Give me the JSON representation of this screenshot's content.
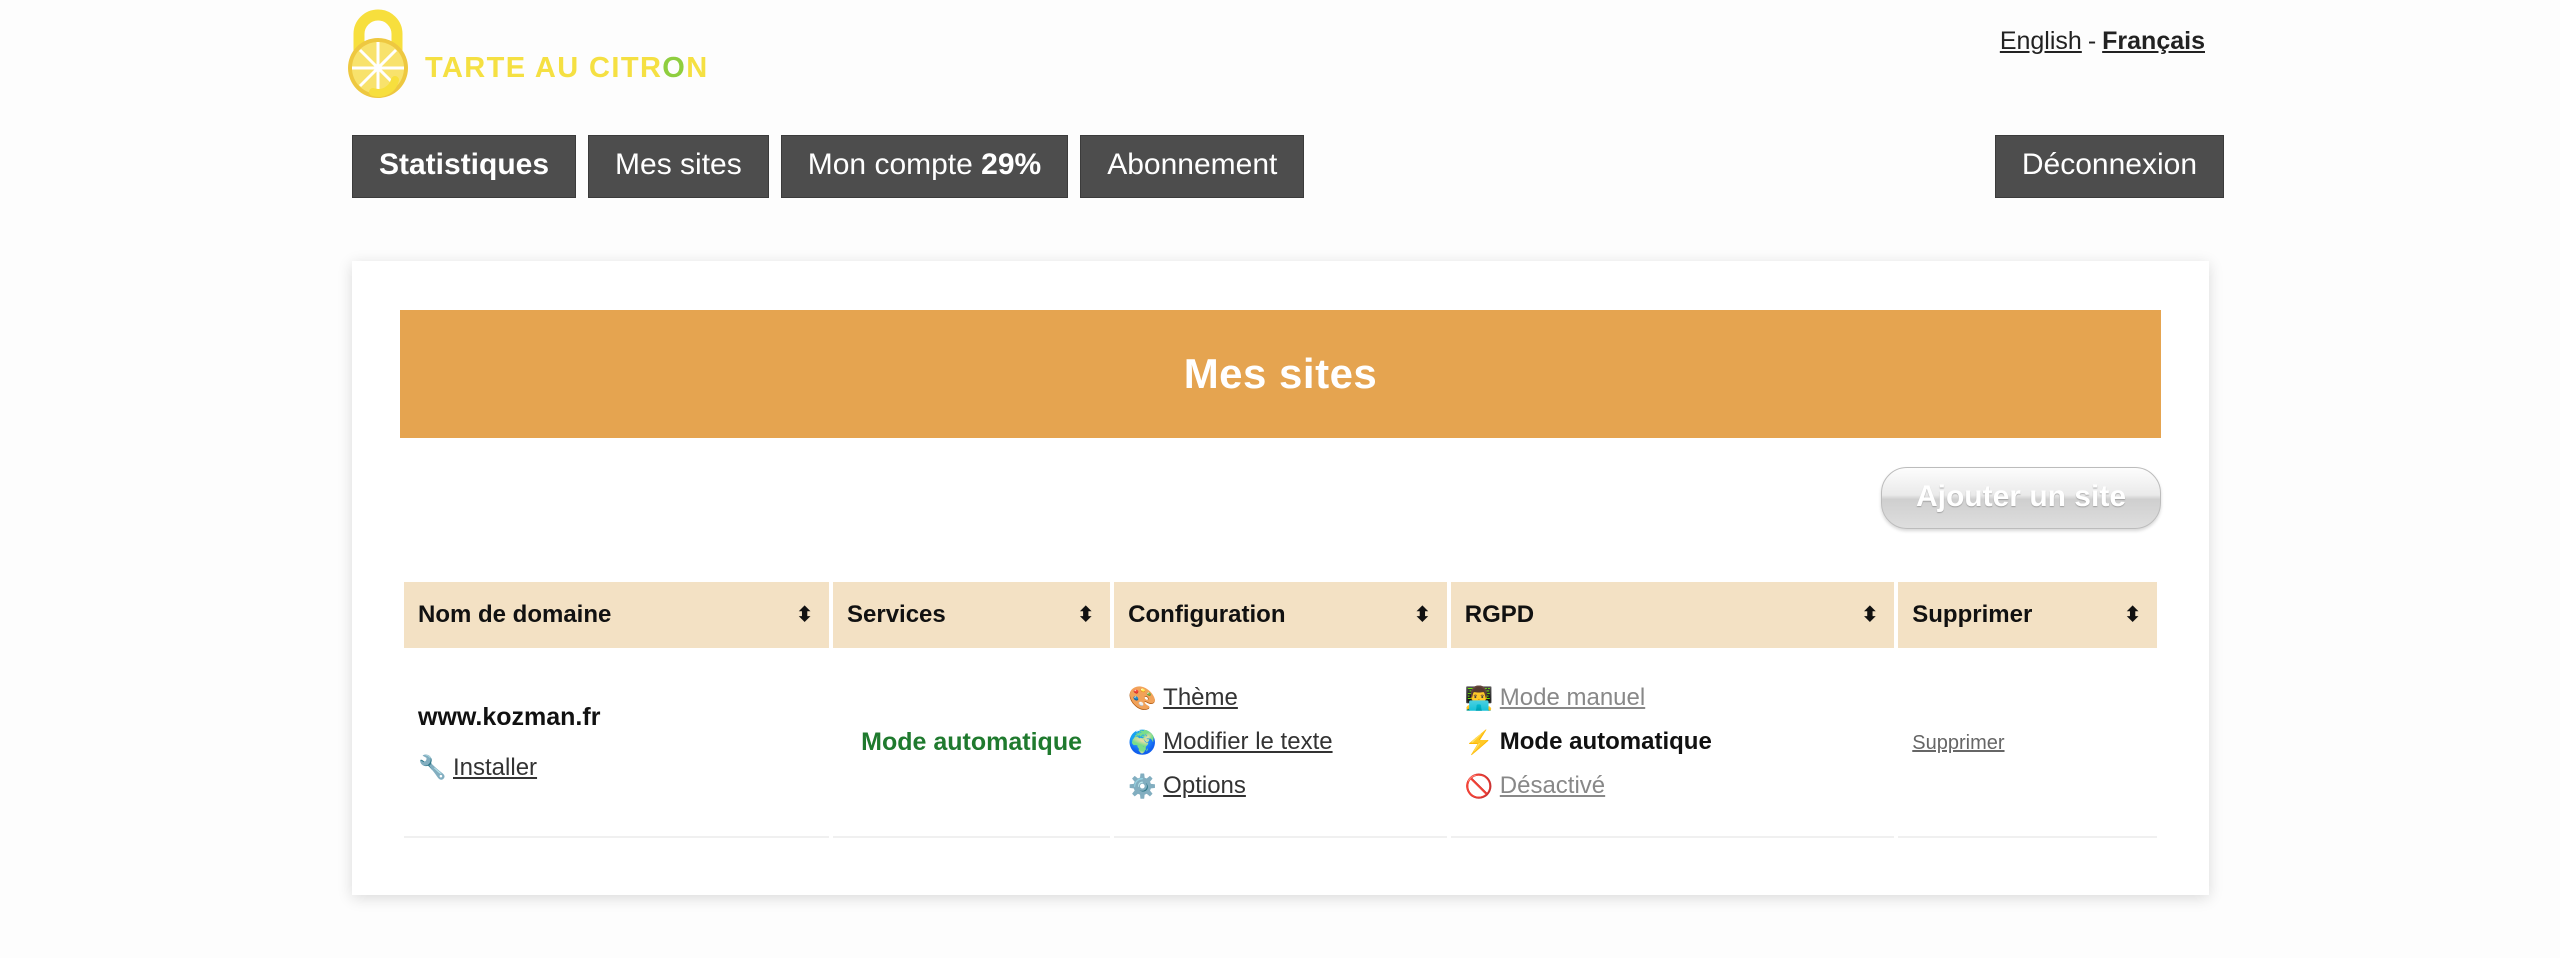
{
  "brand": {
    "name_part1": "TARTE AU CITR",
    "name_o": "O",
    "name_part2": "N",
    "logo_icon": "lemon-padlock-logo",
    "color": "#f5e042",
    "accent_color": "#8fce3f"
  },
  "language": {
    "english": "English",
    "separator": "-",
    "french": "Français",
    "active": "Français"
  },
  "nav": {
    "items": [
      {
        "label": "Statistiques",
        "active": true
      },
      {
        "label": "Mes sites",
        "active": false
      },
      {
        "label_prefix": "Mon compte ",
        "label_value": "29%",
        "active": false
      },
      {
        "label": "Abonnement",
        "active": false
      }
    ],
    "logout_label": "Déconnexion"
  },
  "main": {
    "banner_title": "Mes sites",
    "banner_color": "#e5a450",
    "add_site_label": "Ajouter un site"
  },
  "table": {
    "headers": [
      {
        "label": "Nom de domaine",
        "sort_icon": "⬍"
      },
      {
        "label": "Services",
        "sort_icon": "⬍"
      },
      {
        "label": "Configuration",
        "sort_icon": "⬍"
      },
      {
        "label": "RGPD",
        "sort_icon": "⬍"
      },
      {
        "label": "Supprimer",
        "sort_icon": "⬍"
      }
    ],
    "rows": [
      {
        "domain": "www.kozman.fr",
        "install": {
          "icon": "🔧",
          "icon_name": "wrench-icon",
          "label": "Installer"
        },
        "services": {
          "label": "Mode automatique",
          "color": "#1f7a2e"
        },
        "configuration": [
          {
            "icon": "🎨",
            "icon_name": "palette-icon",
            "label": "Thème"
          },
          {
            "icon": "🌍",
            "icon_name": "globe-icon",
            "label": "Modifier le texte"
          },
          {
            "icon": "⚙️",
            "icon_name": "gear-icon",
            "label": "Options"
          }
        ],
        "rgpd": [
          {
            "icon": "👨‍💻",
            "icon_name": "person-laptop-icon",
            "label": "Mode manuel",
            "state": "inactive"
          },
          {
            "icon": "⚡",
            "icon_name": "lightning-icon",
            "label": "Mode automatique",
            "state": "active"
          },
          {
            "icon": "🚫",
            "icon_name": "prohibited-icon",
            "label": "Désactivé",
            "state": "inactive"
          }
        ],
        "delete_label": "Supprimer"
      }
    ]
  }
}
